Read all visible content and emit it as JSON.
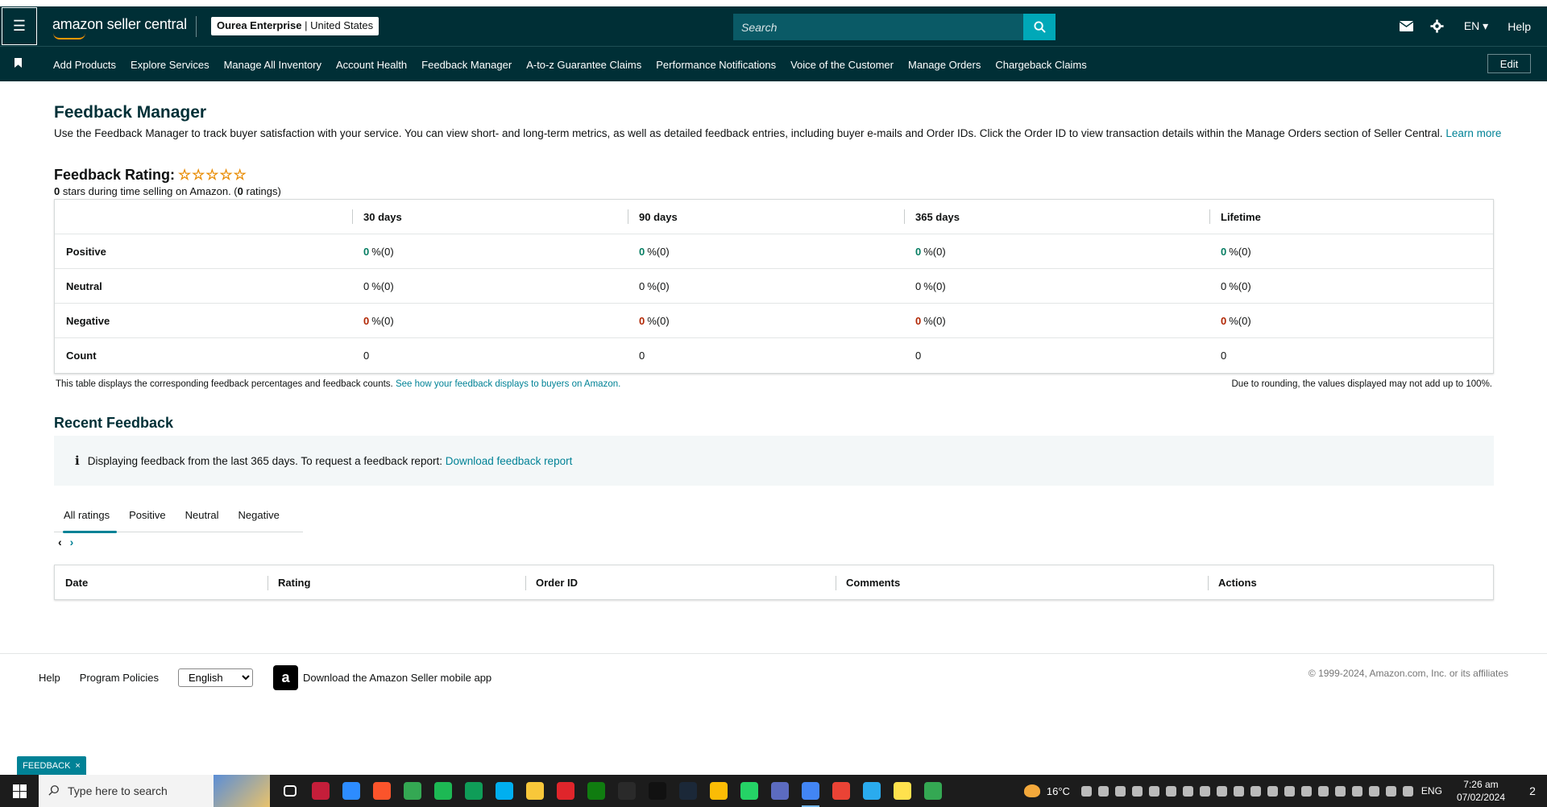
{
  "topbar": {
    "logo": "amazon seller central",
    "merchant_name": "Ourea Enterprise",
    "merchant_region": "United States",
    "search_placeholder": "Search",
    "language": "EN ▾",
    "help": "Help"
  },
  "nav": {
    "items": [
      "Add Products",
      "Explore Services",
      "Manage All Inventory",
      "Account Health",
      "Feedback Manager",
      "A-to-z Guarantee Claims",
      "Performance Notifications",
      "Voice of the Customer",
      "Manage Orders",
      "Chargeback Claims"
    ],
    "edit": "Edit"
  },
  "page": {
    "title": "Feedback Manager",
    "intro": "Use the Feedback Manager to track buyer satisfaction with your service. You can view short- and long-term metrics, as well as detailed feedback entries, including buyer e-mails and Order IDs. Click the Order ID to view transaction details within the Manage Orders section of Seller Central.",
    "learn_more": "Learn more"
  },
  "rating": {
    "title": "Feedback Rating:",
    "stars": 0,
    "stars_glyphs": "☆☆☆☆☆",
    "stars_value": "0",
    "sub_mid": "stars during time selling on Amazon. (",
    "ratings_count": "0",
    "sub_end": "ratings)"
  },
  "metrics": {
    "columns": [
      "30 days",
      "90 days",
      "365 days",
      "Lifetime"
    ],
    "rows": [
      {
        "label": "Positive",
        "values": [
          "0",
          "0",
          "0",
          "0"
        ],
        "suffix": "%(0)",
        "color": "#067d62"
      },
      {
        "label": "Neutral",
        "values": [
          "0",
          "0",
          "0",
          "0"
        ],
        "suffix": "%(0)",
        "color": "#0f1111"
      },
      {
        "label": "Negative",
        "values": [
          "0",
          "0",
          "0",
          "0"
        ],
        "suffix": "%(0)",
        "color": "#b12704"
      },
      {
        "label": "Count",
        "values": [
          "0",
          "0",
          "0",
          "0"
        ],
        "suffix": "",
        "color": "#0f1111"
      }
    ],
    "note": "This table displays the corresponding feedback percentages and feedback counts.",
    "note_link": "See how your feedback displays to buyers on Amazon.",
    "note_right": "Due to rounding, the values displayed may not add up to 100%."
  },
  "recent": {
    "title": "Recent Feedback",
    "info_text": "Displaying feedback from the last 365 days. To request a feedback report:",
    "info_link": "Download feedback report",
    "tabs": [
      "All ratings",
      "Positive",
      "Neutral",
      "Negative"
    ],
    "active_tab": "All ratings",
    "columns": [
      "Date",
      "Rating",
      "Order ID",
      "Comments",
      "Actions"
    ]
  },
  "footer": {
    "help": "Help",
    "program_policies": "Program Policies",
    "language_selected": "English",
    "download_app": "Download the Amazon Seller mobile app",
    "copyright": "© 1999-2024, Amazon.com, Inc. or its affiliates"
  },
  "feedback_tag": {
    "label": "FEEDBACK",
    "close": "×"
  },
  "taskbar": {
    "search_placeholder": "Type here to search",
    "temperature": "16°C",
    "language": "ENG",
    "time": "7:26 am",
    "date": "07/02/2024",
    "notification_count": "2",
    "apps": [
      {
        "name": "task-view",
        "color": "#ffffff"
      },
      {
        "name": "amd",
        "color": "#c41e3a"
      },
      {
        "name": "zoom",
        "color": "#2d8cff"
      },
      {
        "name": "brave",
        "color": "#fb542b"
      },
      {
        "name": "chrome",
        "color": "#34a853"
      },
      {
        "name": "spotify",
        "color": "#1db954"
      },
      {
        "name": "chat",
        "color": "#0f9d58"
      },
      {
        "name": "skype",
        "color": "#00aff0"
      },
      {
        "name": "file-explorer",
        "color": "#f8c73a"
      },
      {
        "name": "acrobat",
        "color": "#e0252b"
      },
      {
        "name": "xbox",
        "color": "#107c10"
      },
      {
        "name": "epic-games",
        "color": "#2a2a2a"
      },
      {
        "name": "tiktok",
        "color": "#111111"
      },
      {
        "name": "steam",
        "color": "#1b2838"
      },
      {
        "name": "chrome-2",
        "color": "#fbbc05"
      },
      {
        "name": "whatsapp",
        "color": "#25d366"
      },
      {
        "name": "calculator",
        "color": "#5c6bc0"
      },
      {
        "name": "chrome-profile",
        "color": "#4285f4"
      },
      {
        "name": "chrome-3",
        "color": "#ea4335"
      },
      {
        "name": "telegram",
        "color": "#2aabee"
      },
      {
        "name": "sticky-notes",
        "color": "#ffe14d"
      },
      {
        "name": "chrome-4",
        "color": "#34a853"
      }
    ]
  }
}
